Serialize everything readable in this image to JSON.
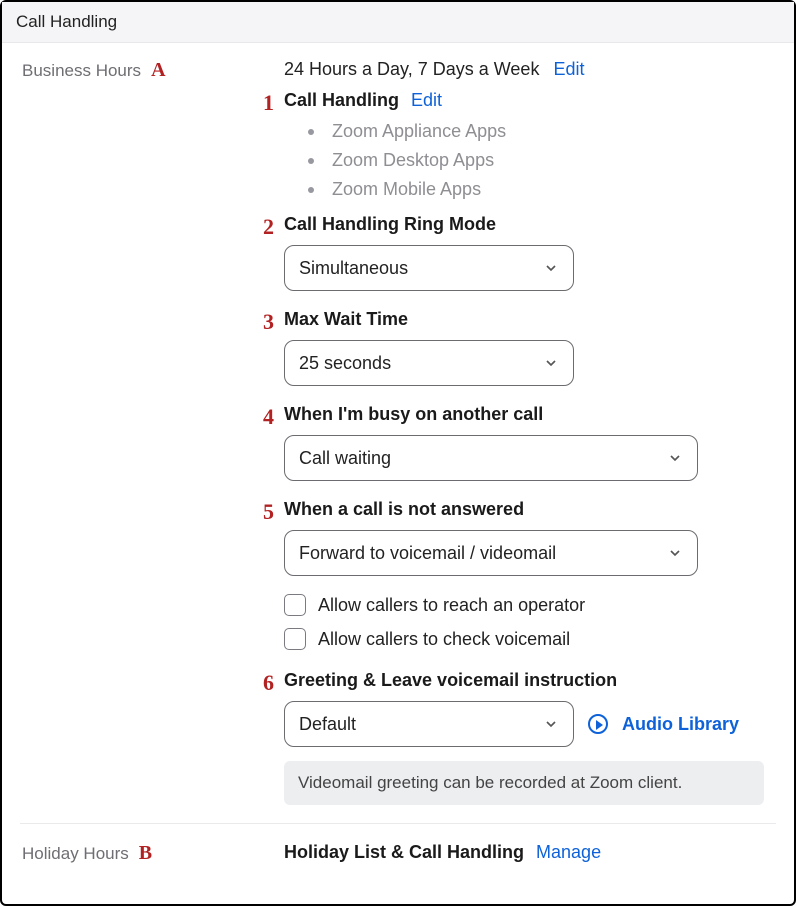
{
  "panel_title": "Call Handling",
  "annotations": {
    "letter_a": "A",
    "letter_b": "B",
    "n1": "1",
    "n2": "2",
    "n3": "3",
    "n4": "4",
    "n5": "5",
    "n6": "6"
  },
  "business_hours": {
    "section_label": "Business Hours",
    "schedule_text": "24 Hours a Day, 7 Days a Week",
    "schedule_edit": "Edit",
    "call_handling_label": "Call Handling",
    "call_handling_edit": "Edit",
    "apps": [
      "Zoom Appliance Apps",
      "Zoom Desktop Apps",
      "Zoom Mobile Apps"
    ],
    "ring_mode_label": "Call Handling Ring Mode",
    "ring_mode_value": "Simultaneous",
    "max_wait_label": "Max Wait Time",
    "max_wait_value": "25 seconds",
    "when_busy_label": "When I'm busy on another call",
    "when_busy_value": "Call waiting",
    "when_unanswered_label": "When a call is not answered",
    "when_unanswered_value": "Forward to voicemail / videomail",
    "allow_operator_label": "Allow callers to reach an operator",
    "allow_check_vm_label": "Allow callers to check voicemail",
    "greeting_label": "Greeting & Leave voicemail instruction",
    "greeting_value": "Default",
    "audio_library_link": "Audio Library",
    "videomail_note": "Videomail greeting can be recorded at Zoom client."
  },
  "holiday_hours": {
    "section_label": "Holiday Hours",
    "title": "Holiday List & Call Handling",
    "manage_link": "Manage"
  }
}
